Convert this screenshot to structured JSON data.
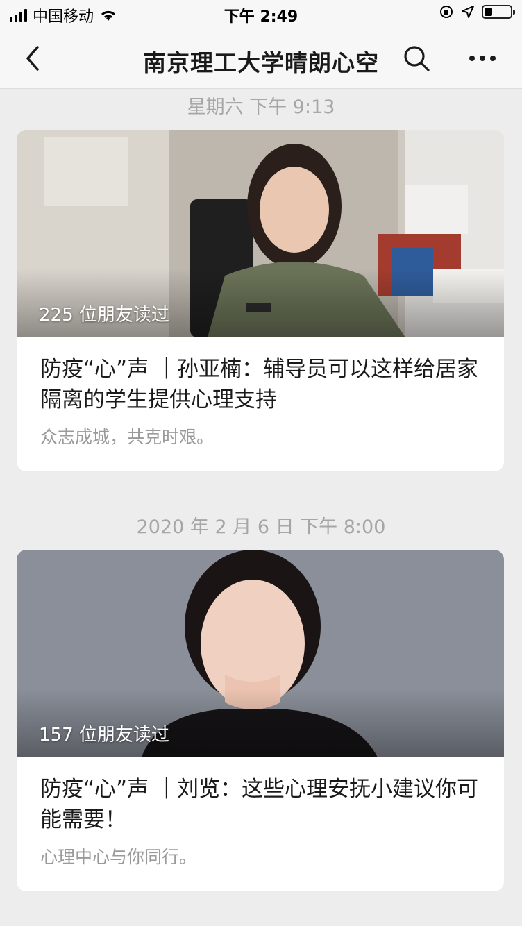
{
  "status_bar": {
    "carrier": "中国移动",
    "time": "下午 2:49"
  },
  "nav": {
    "title": "南京理工大学晴朗心空",
    "icons": [
      "back-icon",
      "search-icon",
      "more-icon"
    ]
  },
  "feed": [
    {
      "date": "星期六 下午 9:13",
      "reads": "225 位朋友读过",
      "headline": "防疫“心”声 ｜孙亚楠：辅导员可以这样给居家隔离的学生提供心理支持",
      "digest": "众志成城，共克时艰。"
    },
    {
      "date": "2020 年 2 月 6 日 下午 8:00",
      "reads": "157 位朋友读过",
      "headline": "防疫“心”声 ｜刘览：这些心理安抚小建议你可能需要！",
      "digest": "心理中心与你同行。"
    }
  ],
  "colors": {
    "background": "#ededed",
    "card": "#ffffff",
    "muted_text": "#a6a6a6"
  }
}
